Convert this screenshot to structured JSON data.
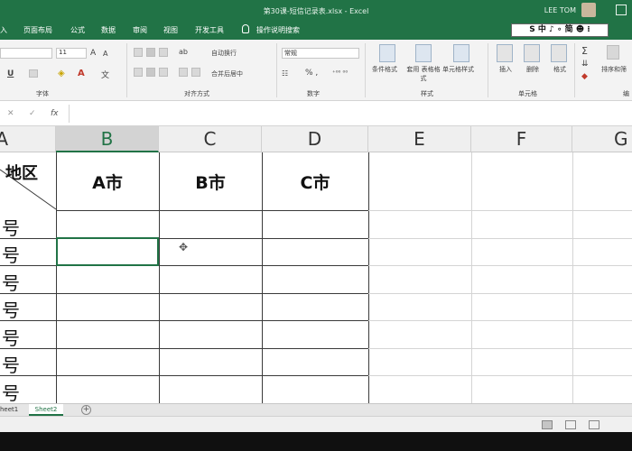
{
  "window": {
    "title": "第30课-短信记录表.xlsx - Excel",
    "user": "LEE TOM"
  },
  "tabs": [
    "入",
    "页面布局",
    "公式",
    "数据",
    "审阅",
    "视图",
    "开发工具",
    "操作说明搜索"
  ],
  "ime": "S 中 ♪ ∘ 简 ☻ ⁝",
  "ribbon": {
    "font_size": "11",
    "wrap_text": "自动换行",
    "merge_center": "合并后居中",
    "number_format": "常规",
    "percent": "% ,",
    "conditional_format": "条件格式",
    "format_table": "套用 表格格式",
    "cell_styles": "单元格样式",
    "insert": "插入",
    "delete": "删除",
    "format": "格式",
    "sort_filter": "排序和筛",
    "groups": {
      "font": "字体",
      "alignment": "对齐方式",
      "number": "数字",
      "styles": "样式",
      "cells": "单元格",
      "editing": "编"
    }
  },
  "formula_bar": {
    "fx": "fx",
    "value": ""
  },
  "grid": {
    "columns": [
      "A",
      "B",
      "C",
      "D",
      "E",
      "F",
      "G"
    ],
    "selected_column": "B",
    "corner_label": "地区",
    "city_headers": [
      "A市",
      "B市",
      "C市"
    ],
    "row_labels": [
      "号",
      "号",
      "号",
      "号",
      "号",
      "号",
      "号"
    ]
  },
  "sheets": [
    "heet1",
    "Sheet2"
  ],
  "active_sheet": "Sheet2",
  "colors": {
    "accent": "#217346",
    "ribbon_bg": "#f3f3f3"
  }
}
